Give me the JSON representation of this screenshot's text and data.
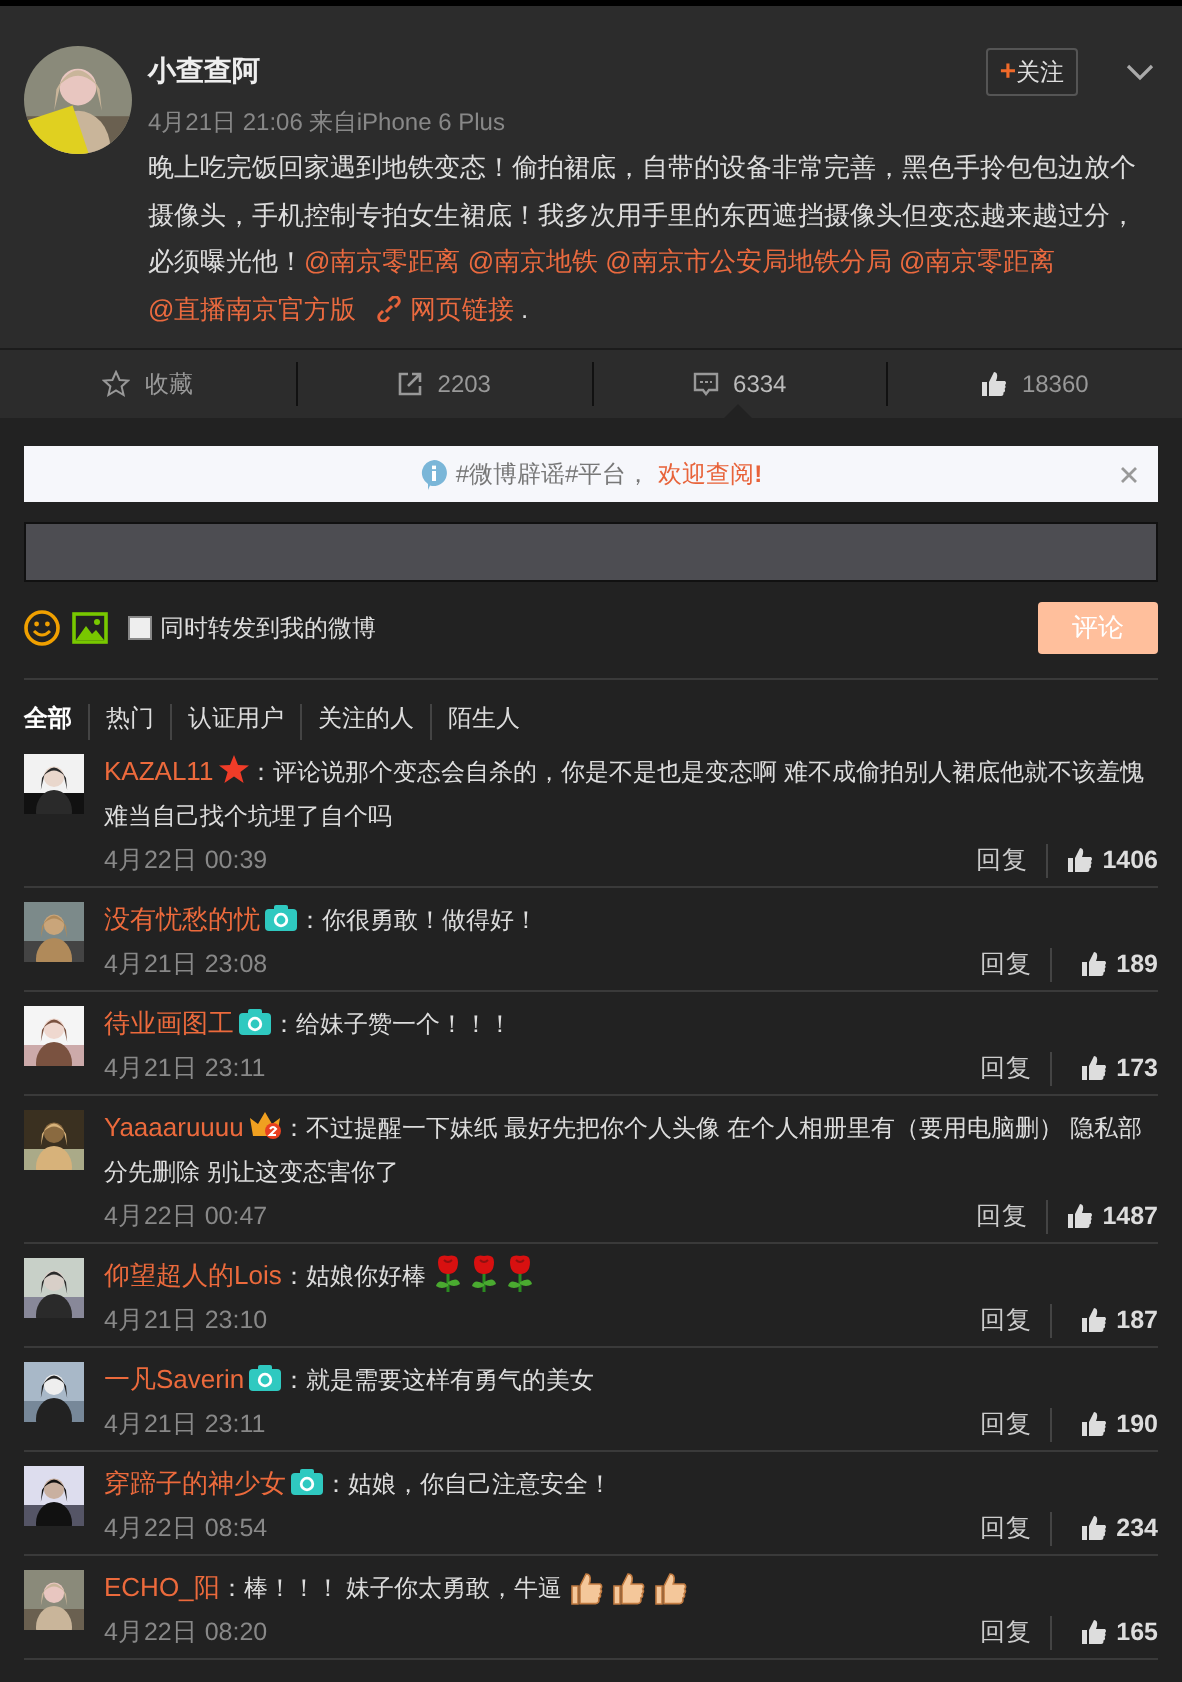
{
  "post": {
    "author": "小查查阿",
    "follow_button": "关注",
    "follow_plus": "+",
    "time": "4月21日 21:06",
    "source_prefix": "来自",
    "source": "iPhone 6 Plus",
    "segments": [
      {
        "kind": "text",
        "text": "晚上吃完饭回家遇到地铁变态！偷拍裙底，自带的设备非常完善，黑色手拎包包边放个摄像头，手机控制专拍女生裙底！我多次用手里的东西遮挡摄像头但变态越来越过分，必须曝光他！"
      },
      {
        "kind": "mention",
        "text": "@南京零距离"
      },
      {
        "kind": "mention",
        "text": "@南京地铁"
      },
      {
        "kind": "mention",
        "text": "@南京市公安局地铁分局"
      },
      {
        "kind": "mention",
        "text": "@南京零距离"
      },
      {
        "kind": "mention",
        "text": "@直播南京官方版"
      },
      {
        "kind": "link",
        "text": "网页链接"
      },
      {
        "kind": "text",
        "text": "."
      }
    ]
  },
  "actions": [
    {
      "kind": "favorite",
      "label": "收藏",
      "selected": false
    },
    {
      "kind": "repost",
      "label": "2203",
      "selected": false
    },
    {
      "kind": "comment",
      "label": "6334",
      "selected": true
    },
    {
      "kind": "like",
      "label": "18360",
      "selected": false
    }
  ],
  "notice": {
    "text": "#微博辟谣#平台，",
    "link": "欢迎查阅",
    "mark": "!"
  },
  "composer": {
    "repost_label": "同时转发到我的微博",
    "repost_checked": false,
    "submit": "评论"
  },
  "filters": [
    {
      "label": "全部",
      "selected": true
    },
    {
      "label": "热门",
      "selected": false
    },
    {
      "label": "认证用户",
      "selected": false
    },
    {
      "label": "关注的人",
      "selected": false
    },
    {
      "label": "陌生人",
      "selected": false
    }
  ],
  "comments": [
    {
      "name": "KAZAL11",
      "badge": {
        "kind": "star"
      },
      "text": "：评论说那个变态会自杀的，你是不是也是变态啊 难不成偷拍别人裙底他就不该羞愧难当自己找个坑埋了自个吗",
      "time": "4月22日 00:39",
      "reply": "回复",
      "likes": "1406"
    },
    {
      "name": "没有忧愁的忧",
      "badge": {
        "kind": "camera"
      },
      "text": "：你很勇敢！做得好！",
      "time": "4月21日 23:08",
      "reply": "回复",
      "likes": "189"
    },
    {
      "name": "待业画图工",
      "badge": {
        "kind": "camera"
      },
      "text": "：给妹子赞一个！！！",
      "time": "4月21日 23:11",
      "reply": "回复",
      "likes": "173"
    },
    {
      "name": "Yaaaaruuuu",
      "badge": {
        "kind": "crown"
      },
      "text": "：不过提醒一下妹纸 最好先把你个人头像 在个人相册里有（要用电脑删） 隐私部分先删除 别让这变态害你了",
      "time": "4月22日 00:47",
      "reply": "回复",
      "likes": "1487"
    },
    {
      "name": "仰望超人的Lois",
      "text": "：姑娘你好棒",
      "emojis": [
        {
          "kind": "rose"
        },
        {
          "kind": "rose"
        },
        {
          "kind": "rose"
        }
      ],
      "time": "4月21日 23:10",
      "reply": "回复",
      "likes": "187"
    },
    {
      "name": "一凡Saverin",
      "badge": {
        "kind": "camera"
      },
      "text": "：就是需要这样有勇气的美女",
      "time": "4月21日 23:11",
      "reply": "回复",
      "likes": "190"
    },
    {
      "name": "穿蹄子的神少女",
      "badge": {
        "kind": "camera"
      },
      "text": "：姑娘，你自己注意安全！",
      "time": "4月22日 08:54",
      "reply": "回复",
      "likes": "234"
    },
    {
      "name": "ECHO_阳",
      "text": "：棒！！！ 妹子你太勇敢，牛逼",
      "emojis": [
        {
          "kind": "thumbs"
        },
        {
          "kind": "thumbs"
        },
        {
          "kind": "thumbs"
        }
      ],
      "time": "4月22日 08:20",
      "reply": "回复",
      "likes": "165"
    }
  ]
}
